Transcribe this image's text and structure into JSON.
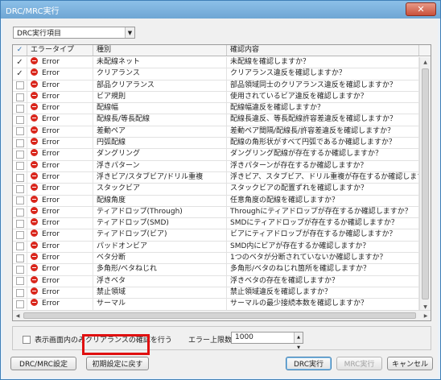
{
  "window": {
    "title": "DRC/MRC実行",
    "close_icon": "close-icon"
  },
  "dropdown": {
    "value": "DRC実行項目"
  },
  "grid": {
    "headers": {
      "check": "✓",
      "type": "エラータイプ",
      "kind": "種別",
      "desc": "確認内容"
    },
    "rows": [
      {
        "checked": true,
        "type": "Error",
        "kind": "未配線ネット",
        "desc": "未配線を確認しますか？"
      },
      {
        "checked": true,
        "type": "Error",
        "kind": "クリアランス",
        "desc": "クリアランス違反を確認しますか？"
      },
      {
        "checked": false,
        "type": "Error",
        "kind": "部品クリアランス",
        "desc": "部品領域同士のクリアランス違反を確認しますか？"
      },
      {
        "checked": false,
        "type": "Error",
        "kind": "ビア規則",
        "desc": "使用されているビア違反を確認しますか？"
      },
      {
        "checked": false,
        "type": "Error",
        "kind": "配線幅",
        "desc": "配線幅違反を確認しますか？"
      },
      {
        "checked": false,
        "type": "Error",
        "kind": "配線長/等長配線",
        "desc": "配線長違反、等長配線許容差違反を確認しますか？"
      },
      {
        "checked": false,
        "type": "Error",
        "kind": "差動ペア",
        "desc": "差動ペア間隔/配線長/許容差違反を確認しますか？"
      },
      {
        "checked": false,
        "type": "Error",
        "kind": "円弧配線",
        "desc": "配線の角形状がすべて円弧であるか確認しますか？"
      },
      {
        "checked": false,
        "type": "Error",
        "kind": "ダングリング",
        "desc": "ダングリング配線が存在するか確認しますか？"
      },
      {
        "checked": false,
        "type": "Error",
        "kind": "浮きパターン",
        "desc": "浮きパターンが存在するか確認しますか？"
      },
      {
        "checked": false,
        "type": "Error",
        "kind": "浮きビア/スタブビア/ドリル重複",
        "desc": "浮きビア、スタブビア、ドリル重複が存在するか確認しますか？"
      },
      {
        "checked": false,
        "type": "Error",
        "kind": "スタックビア",
        "desc": "スタックビアの配置ずれを確認しますか？"
      },
      {
        "checked": false,
        "type": "Error",
        "kind": "配線角度",
        "desc": "任意角度の配線を確認しますか？"
      },
      {
        "checked": false,
        "type": "Error",
        "kind": "ティアドロップ(Through)",
        "desc": "Throughにティアドロップが存在するか確認しますか？"
      },
      {
        "checked": false,
        "type": "Error",
        "kind": "ティアドロップ(SMD)",
        "desc": "SMDにティアドロップが存在するか確認しますか？"
      },
      {
        "checked": false,
        "type": "Error",
        "kind": "ティアドロップ(ビア)",
        "desc": "ビアにティアドロップが存在するか確認しますか？"
      },
      {
        "checked": false,
        "type": "Error",
        "kind": "パッドオンビア",
        "desc": "SMD内にビアが存在するか確認しますか？"
      },
      {
        "checked": false,
        "type": "Error",
        "kind": "ベタ分断",
        "desc": "1つのベタが分断されていないか確認しますか？"
      },
      {
        "checked": false,
        "type": "Error",
        "kind": "多角形/ベタねじれ",
        "desc": "多角形/ベタのねじれ箇所を確認しますか？"
      },
      {
        "checked": false,
        "type": "Error",
        "kind": "浮きベタ",
        "desc": "浮きベタの存在を確認しますか？"
      },
      {
        "checked": false,
        "type": "Error",
        "kind": "禁止領域",
        "desc": "禁止領域違反を確認しますか？"
      },
      {
        "checked": false,
        "type": "Error",
        "kind": "サーマル",
        "desc": "サーマルの最少接続本数を確認しますか？"
      }
    ]
  },
  "options": {
    "clearance_visible_only_label": "表示画面内のみクリアランスの確認を行う",
    "error_limit_label": "エラー上限数",
    "error_limit_value": "1000"
  },
  "buttons": {
    "drc_mrc_settings": "DRC/MRC設定",
    "reset_defaults": "初期設定に戻す",
    "run_drc": "DRC実行",
    "run_mrc": "MRC実行",
    "cancel": "キャンセル"
  },
  "colors": {
    "error_icon": "#d9261c",
    "highlight": "#e01010",
    "title_bar": "#7ab3df"
  }
}
